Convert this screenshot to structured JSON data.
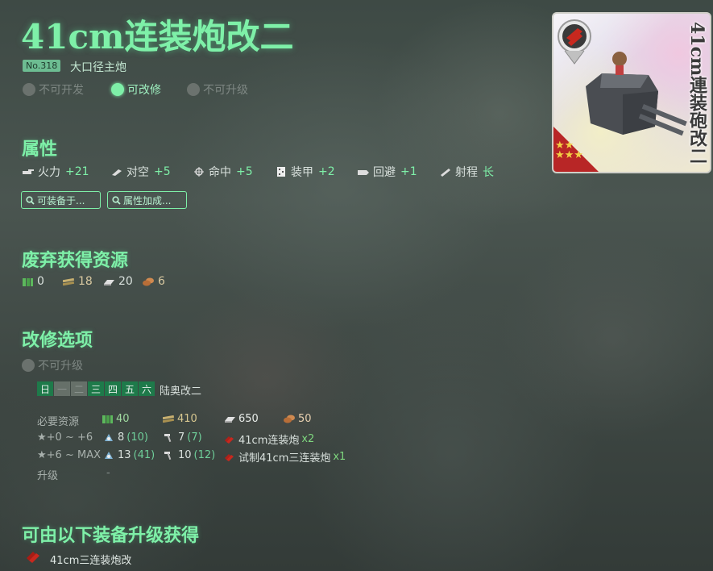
{
  "header": {
    "title": "41cm连装炮改二",
    "number": "No.318",
    "type": "大口径主炮",
    "flags": [
      {
        "label": "不可开发",
        "active": false
      },
      {
        "label": "可改修",
        "active": true
      },
      {
        "label": "不可升级",
        "active": false
      }
    ]
  },
  "attributes": {
    "heading": "属性",
    "stats": [
      {
        "label": "火力",
        "value": "+21",
        "icon": "firepower-icon"
      },
      {
        "label": "对空",
        "value": "+5",
        "icon": "antiair-icon"
      },
      {
        "label": "命中",
        "value": "+5",
        "icon": "accuracy-icon"
      },
      {
        "label": "装甲",
        "value": "+2",
        "icon": "armor-icon"
      },
      {
        "label": "回避",
        "value": "+1",
        "icon": "evasion-icon"
      },
      {
        "label": "射程",
        "value": "长",
        "icon": "range-icon"
      }
    ],
    "buttons": [
      {
        "label": "可装备于...",
        "icon": "search-icon"
      },
      {
        "label": "属性加成...",
        "icon": "search-icon"
      }
    ]
  },
  "scrap": {
    "heading": "废弃获得资源",
    "resources": [
      {
        "icon": "fuel-icon",
        "value": "0",
        "color": "#5cb85c"
      },
      {
        "icon": "ammo-icon",
        "value": "18",
        "color": "#b0a060"
      },
      {
        "icon": "steel-icon",
        "value": "20",
        "color": "#c8c8c8"
      },
      {
        "icon": "bauxite-icon",
        "value": "6",
        "color": "#c8804a"
      }
    ]
  },
  "improvement": {
    "heading": "改修选项",
    "upgrade_status": "不可升级",
    "days": [
      {
        "label": "日",
        "on": true
      },
      {
        "label": "一",
        "on": false
      },
      {
        "label": "二",
        "on": false
      },
      {
        "label": "三",
        "on": true
      },
      {
        "label": "四",
        "on": true
      },
      {
        "label": "五",
        "on": true
      },
      {
        "label": "六",
        "on": true
      }
    ],
    "ship": "陆奥改二",
    "required_label": "必要资源",
    "required": {
      "fuel": "40",
      "ammo": "410",
      "steel": "650",
      "bauxite": "50"
    },
    "rows": [
      {
        "label": "★+0 ~ +6",
        "dev": "8",
        "dev_sure": "(10)",
        "screw": "7",
        "screw_sure": "(7)",
        "item": "41cm连装炮",
        "item_count": "x2"
      },
      {
        "label": "★+6 ~ MAX",
        "dev": "13",
        "dev_sure": "(41)",
        "screw": "10",
        "screw_sure": "(12)",
        "item": "试制41cm三连装炮",
        "item_count": "x1"
      }
    ],
    "upgrade_label": "升级",
    "upgrade_value": "-"
  },
  "obtain": {
    "heading": "可由以下装备升级获得",
    "item": "41cm三连装炮改"
  },
  "card": {
    "title": "41cm連装砲改二",
    "stars": 5
  }
}
